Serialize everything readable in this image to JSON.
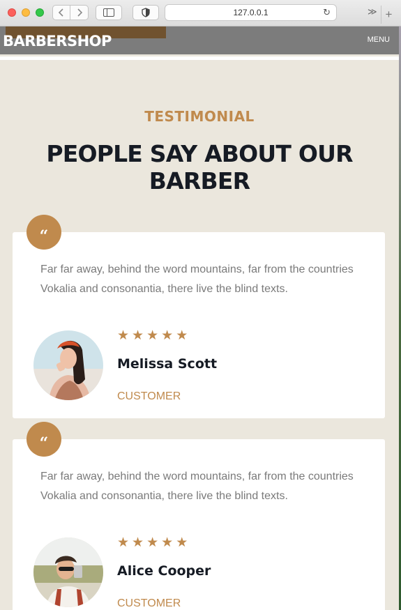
{
  "browser": {
    "url": "127.0.0.1",
    "icons": [
      "back-icon",
      "forward-icon",
      "sidebar-icon",
      "shield-icon",
      "reload-icon",
      "more-icon",
      "plus-icon"
    ]
  },
  "navbar": {
    "brand": "BARBERSHOP",
    "menu_label": "MENU"
  },
  "section": {
    "subtitle": "TESTIMONIAL",
    "title": "PEOPLE SAY ABOUT OUR BARBER"
  },
  "testimonials": [
    {
      "quote_mark": "“",
      "text": "Far far away, behind the word mountains, far from the countries Vokalia and consonantia, there live the blind texts.",
      "rating": 5,
      "name": "Melissa Scott",
      "role": "CUSTOMER"
    },
    {
      "quote_mark": "“",
      "text": "Far far away, behind the word mountains, far from the countries Vokalia and consonantia, there live the blind texts.",
      "rating": 5,
      "name": "Alice Cooper",
      "role": "CUSTOMER"
    }
  ],
  "colors": {
    "accent": "#c08a4d",
    "page_background": "#ebe7dd",
    "heading": "#161b24",
    "navbar": "#7c7c7c"
  }
}
